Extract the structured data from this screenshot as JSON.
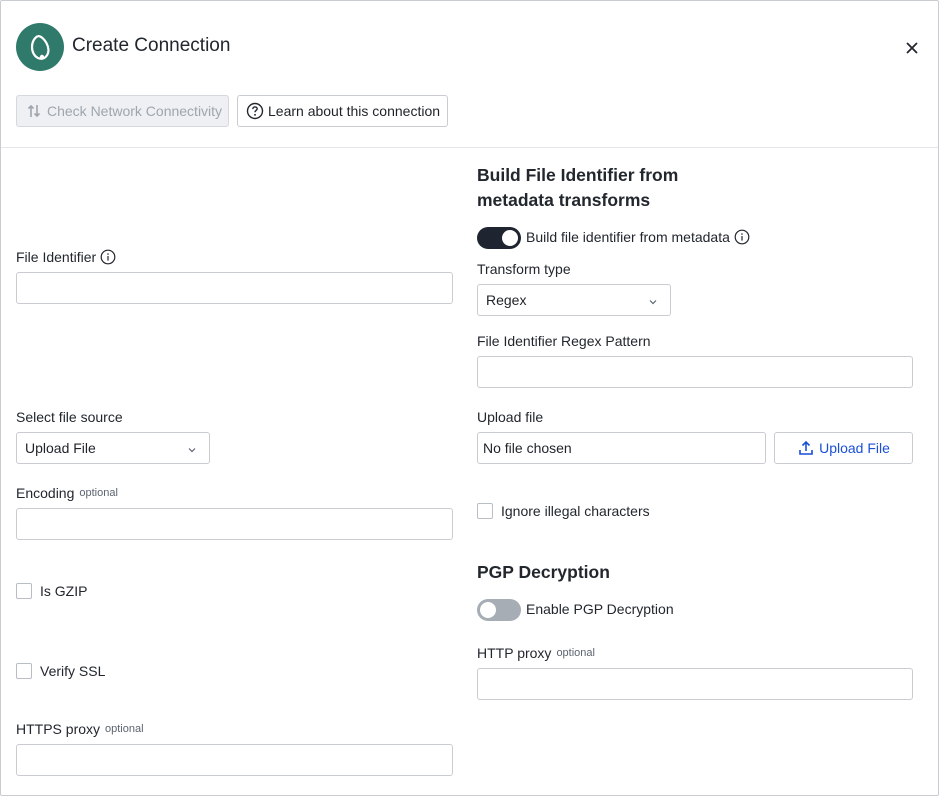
{
  "header": {
    "title": "Create Connection"
  },
  "toolbar": {
    "check_network_label": "Check Network Connectivity",
    "learn_label": "Learn about this connection"
  },
  "left": {
    "file_identifier_label": "File Identifier",
    "file_identifier_value": "",
    "file_source_label": "Select file source",
    "file_source_value": "Upload File",
    "encoding_label": "Encoding",
    "encoding_optional": "optional",
    "encoding_value": "",
    "is_gzip_label": "Is GZIP",
    "is_gzip_checked": false,
    "verify_ssl_label": "Verify SSL",
    "verify_ssl_checked": false,
    "https_proxy_label": "HTTPS proxy",
    "https_proxy_optional": "optional",
    "https_proxy_value": ""
  },
  "right": {
    "section_title": "Build File Identifier from metadata transforms",
    "build_toggle_label": "Build file identifier from metadata",
    "build_toggle_on": true,
    "transform_type_label": "Transform type",
    "transform_type_value": "Regex",
    "regex_pattern_label": "File Identifier Regex Pattern",
    "regex_pattern_value": "",
    "upload_file_label": "Upload file",
    "upload_file_value": "No file chosen",
    "upload_button_label": "Upload File",
    "ignore_illegal_label": "Ignore illegal characters",
    "ignore_illegal_checked": false,
    "pgp_title": "PGP Decryption",
    "pgp_toggle_label": "Enable PGP Decryption",
    "pgp_toggle_on": false,
    "http_proxy_label": "HTTP proxy",
    "http_proxy_optional": "optional",
    "http_proxy_value": ""
  },
  "colors": {
    "logo": "#2f7a6b",
    "toggle_on": "#1f2530",
    "toggle_off": "#a7adb5",
    "link": "#1a4fd6"
  },
  "icons": {
    "logo": "connection-logo-icon",
    "close": "close-icon",
    "network": "network-arrows-icon",
    "help": "question-circle-icon",
    "info": "info-circle-icon",
    "chevron": "chevron-down-icon",
    "upload": "upload-icon"
  }
}
